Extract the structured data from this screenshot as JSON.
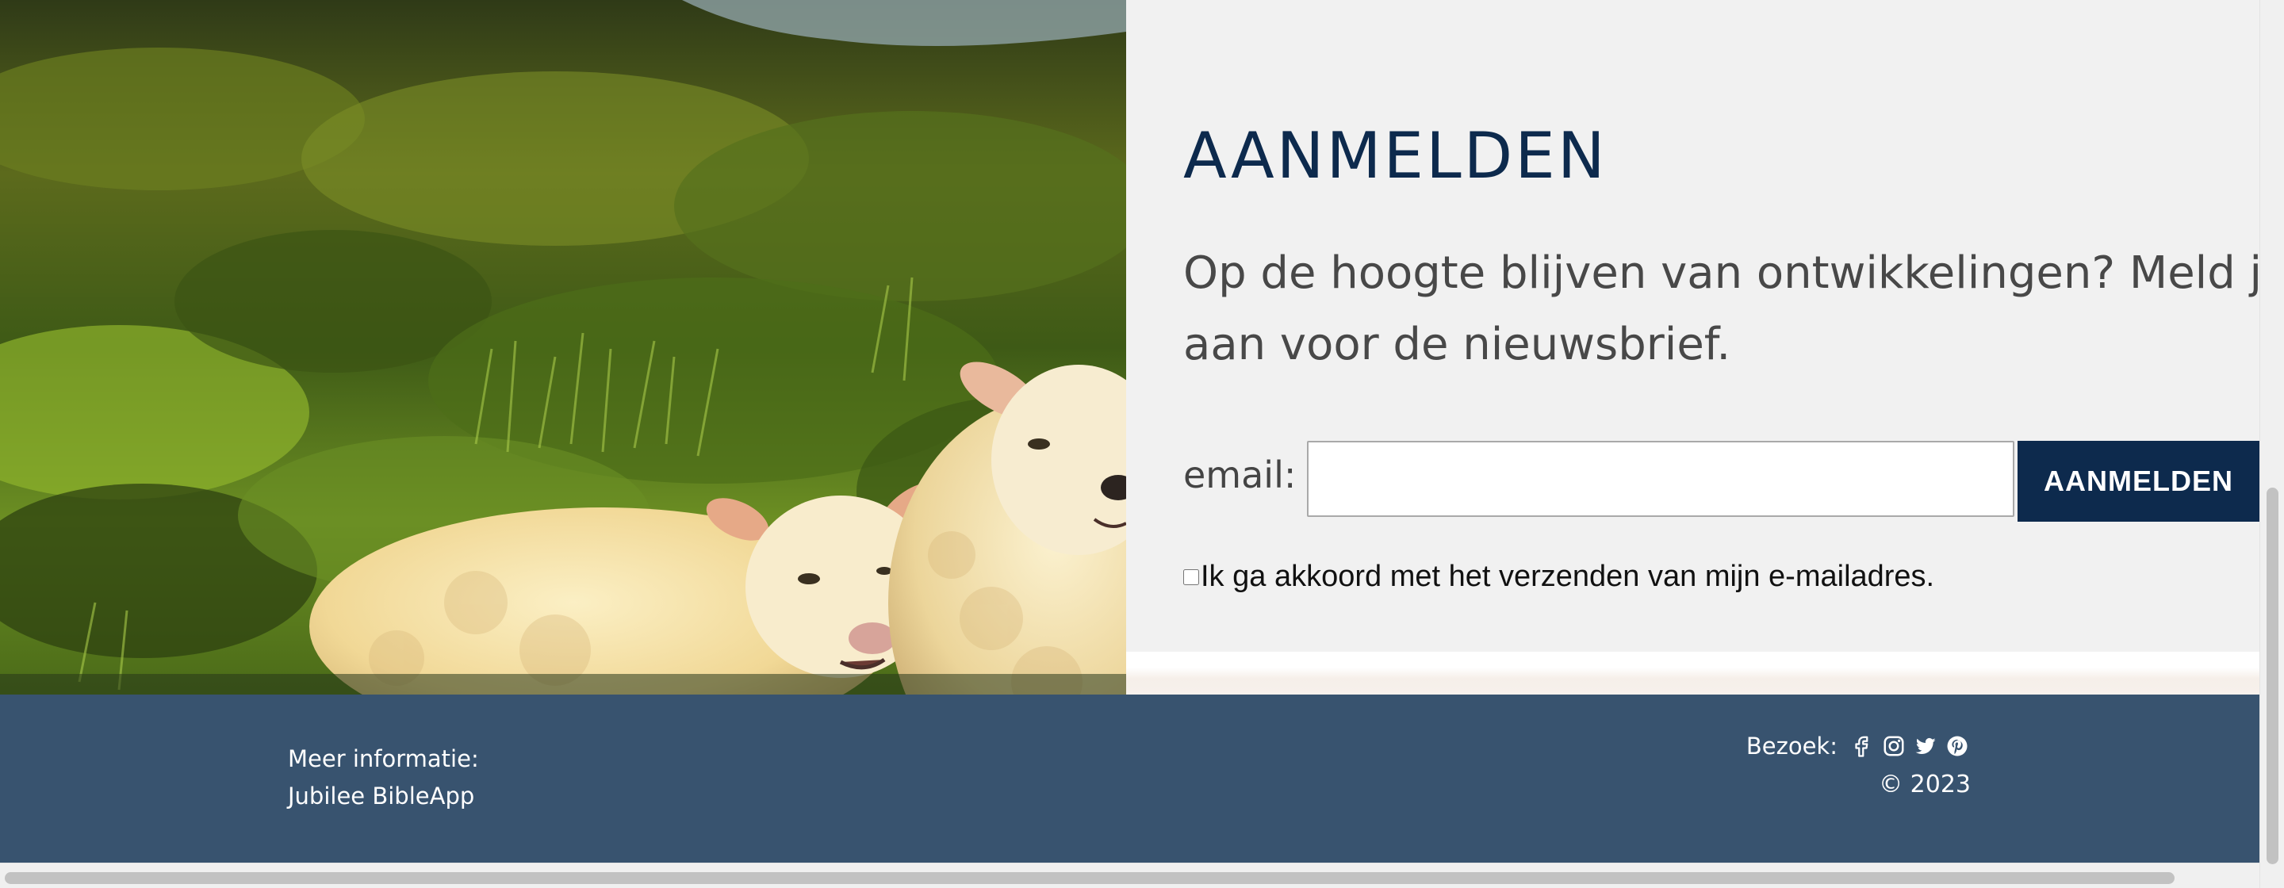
{
  "signup": {
    "title": "AANMELDEN",
    "intro_line1": "Op de hoogte blijven van ontwikkelingen? Meld je dan",
    "intro_line2": "aan voor de nieuwsbrief.",
    "email_label": "email:",
    "email_value": "",
    "submit_label": "AANMELDEN",
    "consent_label": "Ik ga akkoord met het verzenden van mijn e-mailadres.",
    "consent_checked": false
  },
  "footer": {
    "info_label": "Meer informatie:",
    "info_name": "Jubilee BibleApp",
    "visit_label": "Bezoek:",
    "social_icons": [
      "facebook-icon",
      "instagram-icon",
      "twitter-icon",
      "pinterest-icon"
    ],
    "copyright": "© 2023"
  },
  "colors": {
    "brand_navy": "#0d2a4d",
    "footer_bg": "#38536f",
    "panel_bg": "#f1f1f1",
    "text_gray": "#484848"
  }
}
